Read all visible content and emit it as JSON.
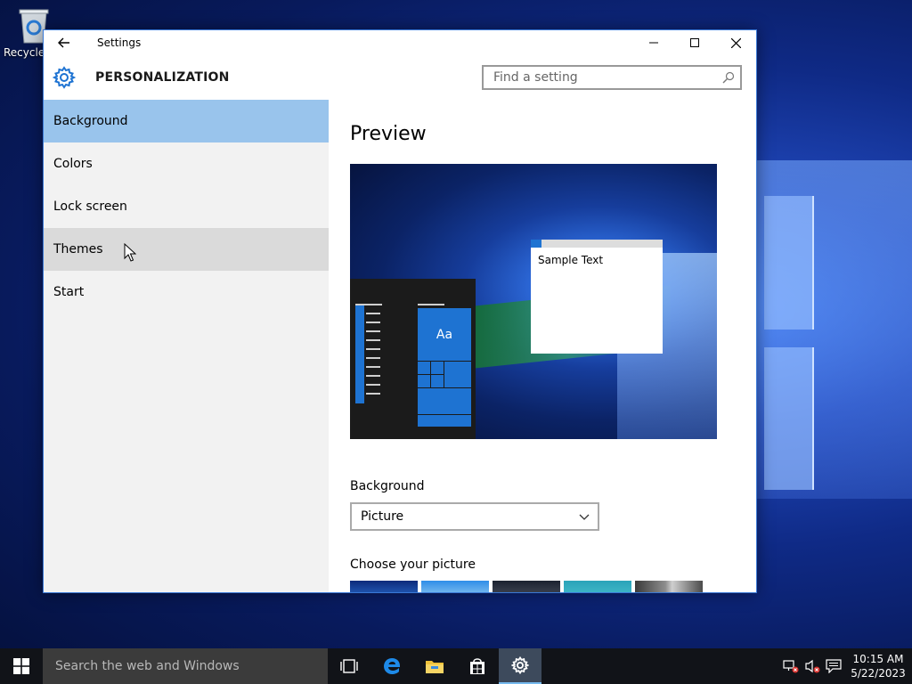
{
  "desktop": {
    "recycle_bin_label": "Recycle Bin"
  },
  "window": {
    "title": "Settings",
    "header_title": "PERSONALIZATION",
    "search_placeholder": "Find a setting",
    "accent_color": "#99c4ec"
  },
  "sidebar": {
    "items": [
      {
        "label": "Background"
      },
      {
        "label": "Colors"
      },
      {
        "label": "Lock screen"
      },
      {
        "label": "Themes"
      },
      {
        "label": "Start"
      }
    ],
    "selected": "Background",
    "hovered": "Themes"
  },
  "content": {
    "preview_heading": "Preview",
    "preview_tile_text": "Aa",
    "preview_sample_text": "Sample Text",
    "background_label": "Background",
    "background_value": "Picture",
    "choose_picture_label": "Choose your picture"
  },
  "taskbar": {
    "search_placeholder": "Search the web and Windows",
    "time": "10:15 AM",
    "date": "5/22/2023",
    "icons": [
      "windows-start-icon",
      "task-view-icon",
      "edge-icon",
      "file-explorer-icon",
      "store-icon",
      "settings-icon"
    ]
  }
}
